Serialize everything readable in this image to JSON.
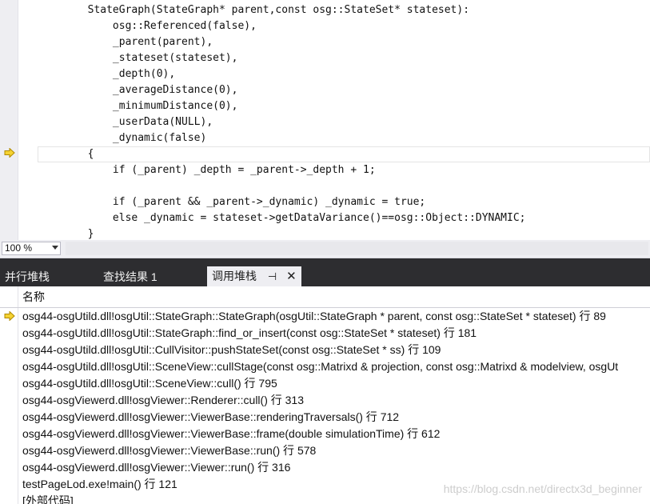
{
  "editor": {
    "lines": [
      "        StateGraph(StateGraph* parent,const osg::StateSet* stateset):",
      "            osg::Referenced(false),",
      "            _parent(parent),",
      "            _stateset(stateset),",
      "            _depth(0),",
      "            _averageDistance(0),",
      "            _minimumDistance(0),",
      "            _userData(NULL),",
      "            _dynamic(false)",
      "        {",
      "            if (_parent) _depth = _parent->_depth + 1;",
      "",
      "            if (_parent && _parent->_dynamic) _dynamic = true;",
      "            else _dynamic = stateset->getDataVariance()==osg::Object::DYNAMIC;",
      "        }"
    ],
    "current_line_index": 9
  },
  "zoom": {
    "value": "100 %"
  },
  "tabs": {
    "parallel_stacks": "并行堆栈",
    "find_results": "查找结果 1",
    "call_stack": "调用堆栈"
  },
  "callstack": {
    "column_name": "名称",
    "rows": [
      "osg44-osgUtild.dll!osgUtil::StateGraph::StateGraph(osgUtil::StateGraph * parent, const osg::StateSet * stateset) 行 89",
      "osg44-osgUtild.dll!osgUtil::StateGraph::find_or_insert(const osg::StateSet * stateset) 行 181",
      "osg44-osgUtild.dll!osgUtil::CullVisitor::pushStateSet(const osg::StateSet * ss) 行 109",
      "osg44-osgUtild.dll!osgUtil::SceneView::cullStage(const osg::Matrixd & projection, const osg::Matrixd & modelview, osgUt",
      "osg44-osgUtild.dll!osgUtil::SceneView::cull() 行 795",
      "osg44-osgViewerd.dll!osgViewer::Renderer::cull() 行 313",
      "osg44-osgViewerd.dll!osgViewer::ViewerBase::renderingTraversals() 行 712",
      "osg44-osgViewerd.dll!osgViewer::ViewerBase::frame(double simulationTime) 行 612",
      "osg44-osgViewerd.dll!osgViewer::ViewerBase::run() 行 578",
      "osg44-osgViewerd.dll!osgViewer::Viewer::run() 行 316",
      "testPageLod.exe!main() 行 121",
      "[外部代码]"
    ]
  },
  "watermark": "https://blog.csdn.net/directx3d_beginner",
  "icons": {
    "exec_pointer": "current-statement-arrow-icon",
    "pin": "pin-icon",
    "close": "close-icon",
    "dropdown": "chevron-down-icon"
  },
  "colors": {
    "tabstrip": "#2d2d30",
    "arrow_fill": "#f5d232",
    "arrow_stroke": "#b08a00"
  }
}
